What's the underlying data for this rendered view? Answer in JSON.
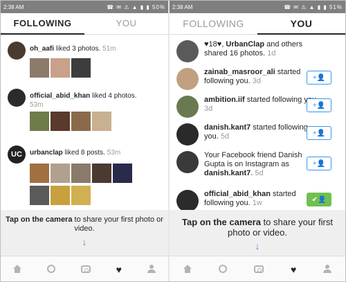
{
  "left": {
    "status": {
      "time": "2:38 AM",
      "icons": "☎ ✉ ⚠ ▲ ▮ ▮ 50%"
    },
    "tabs": {
      "following": "FOLLOWING",
      "you": "YOU"
    },
    "items": [
      {
        "user": "oh_aafi",
        "text": " liked 3 photos.",
        "time": "51m"
      },
      {
        "user": "official_abid_khan",
        "text": " liked 4 photos.",
        "time": "53m"
      },
      {
        "user": "urbanclap",
        "text": " liked 8 posts.",
        "time": "53m",
        "avatar_text": "UC"
      }
    ],
    "promo": {
      "bold": "Tap on the camera",
      "rest": " to share your first photo or video."
    }
  },
  "right": {
    "status": {
      "time": "2:38 AM",
      "icons": "☎ ✉ ⚠ ▲ ▮ ▮ 51%"
    },
    "tabs": {
      "following": "FOLLOWING",
      "you": "YOU"
    },
    "items": [
      {
        "pre": "♥18♥, ",
        "user": "UrbanClap",
        "text": " and others shared 16 photos.",
        "time": "1d"
      },
      {
        "user": "zainab_masroor_ali",
        "text": " started following you.",
        "time": "3d",
        "button": "+👤"
      },
      {
        "user": "ambition.iif",
        "text": " started following you.",
        "time": "3d",
        "button": "+👤"
      },
      {
        "user": "danish.kant7",
        "text": " started following you.",
        "time": "5d",
        "button": "+👤"
      },
      {
        "pre": "Your Facebook friend Danish Gupta is on Instagram as ",
        "user": "danish.kant7",
        "text": ".",
        "time": "5d",
        "button": "+👤"
      },
      {
        "user": "official_abid_khan",
        "text": " started following you.",
        "time": "1w",
        "button": "✔👤"
      }
    ],
    "promo": {
      "bold": "Tap on the camera",
      "rest": " to share your first photo or video."
    }
  },
  "colors": {
    "accent": "#3897f0",
    "following_green": "#70c050",
    "promo_bg": "#efefef"
  }
}
